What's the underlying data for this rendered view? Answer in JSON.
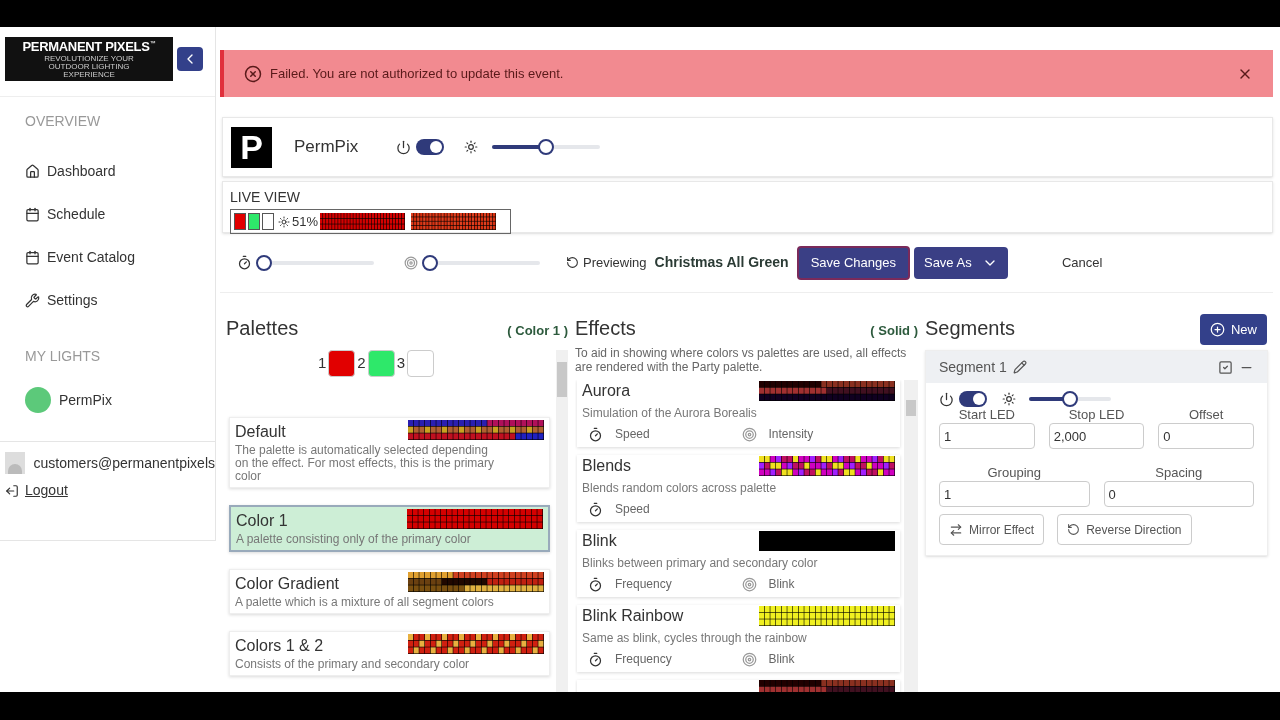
{
  "logo": {
    "title": "PERMANENT PIXELS",
    "trademark": "™",
    "tagline": "REVOLUTIONIZE YOUR OUTDOOR LIGHTING EXPERIENCE"
  },
  "sidebar": {
    "sections": [
      {
        "heading": "OVERVIEW",
        "items": [
          {
            "label": "Dashboard",
            "kind": "home"
          },
          {
            "label": "Schedule",
            "kind": "calendar"
          },
          {
            "label": "Event Catalog",
            "kind": "calendar"
          },
          {
            "label": "Settings",
            "kind": "wrench"
          }
        ]
      },
      {
        "heading": "MY LIGHTS",
        "lights": [
          {
            "label": "PermPix",
            "color": "#5cc97a"
          }
        ]
      }
    ],
    "user": "customers@permanentpixels",
    "logout": "Logout"
  },
  "alert": {
    "message": "Failed. You are not authorized to update this event."
  },
  "device": {
    "letter": "P",
    "name": "PermPix",
    "on": true,
    "level": 0.5
  },
  "live_view": {
    "title": "LIVE VIEW",
    "colors": [
      {
        "color": "#e10000"
      },
      {
        "color": "#2ee86a"
      },
      {
        "color": "#ffffff"
      }
    ],
    "brightness": "51%"
  },
  "controls": {
    "speed": {
      "level": 0
    },
    "intensity": {
      "level": 0
    },
    "previewing": "Previewing",
    "event": "Christmas All Green",
    "buttons": [
      "Save Changes",
      "Save As"
    ],
    "cancel": "Cancel"
  },
  "palettes": {
    "title": "Palettes",
    "current": "( Color 1 )",
    "colors": [
      {
        "label": "1",
        "color": "#e10000"
      },
      {
        "label": "2",
        "color": "#2ee86a"
      },
      {
        "label": "3",
        "color": "#ffffff"
      }
    ],
    "items": [
      {
        "name": "Default",
        "description": "The palette is automatically selected depending on the effect. For most effects, this is the primary color",
        "selected": false
      },
      {
        "name": "Color 1",
        "description": "A palette consisting only of the primary color",
        "selected": true
      },
      {
        "name": "Color Gradient",
        "description": "A palette which is a mixture of all segment colors",
        "selected": false
      },
      {
        "name": "Colors 1 & 2",
        "description": "Consists of the primary and secondary color",
        "selected": false
      }
    ]
  },
  "effects": {
    "title": "Effects",
    "current": "( Solid )",
    "note": "To aid in showing where colors vs palettes are used, all effects are rendered with the Party palette.",
    "items": [
      {
        "name": "Aurora",
        "description": "Simulation of the Aurora Borealis",
        "params": [
          {
            "label": "Speed",
            "kind": "speed"
          },
          {
            "label": "Intensity",
            "kind": "intensity"
          }
        ]
      },
      {
        "name": "Blends",
        "description": "Blends random colors across palette",
        "params": [
          {
            "label": "Speed",
            "kind": "speed"
          }
        ]
      },
      {
        "name": "Blink",
        "description": "Blinks between primary and secondary color",
        "params": [
          {
            "label": "Frequency",
            "kind": "speed"
          },
          {
            "label": "Blink",
            "kind": "intensity"
          }
        ]
      },
      {
        "name": "Blink Rainbow",
        "description": "Same as blink, cycles through the rainbow",
        "params": [
          {
            "label": "Frequency",
            "kind": "speed"
          },
          {
            "label": "Blink",
            "kind": "intensity"
          }
        ]
      }
    ]
  },
  "segments": {
    "title": "Segments",
    "new_button": "New",
    "items": [
      {
        "name": "Segment 1",
        "on": true,
        "level": 0.5,
        "fields": [
          {
            "label": "Start LED",
            "value": "1"
          },
          {
            "label": "Stop LED",
            "value": "2,000"
          },
          {
            "label": "Offset",
            "value": "0"
          },
          {
            "label": "Grouping",
            "value": "1"
          },
          {
            "label": "Spacing",
            "value": "0"
          }
        ],
        "buttons": [
          {
            "label": "Mirror Effect",
            "kind": "mirror"
          },
          {
            "label": "Reverse Direction",
            "kind": "reverse"
          }
        ]
      }
    ]
  }
}
